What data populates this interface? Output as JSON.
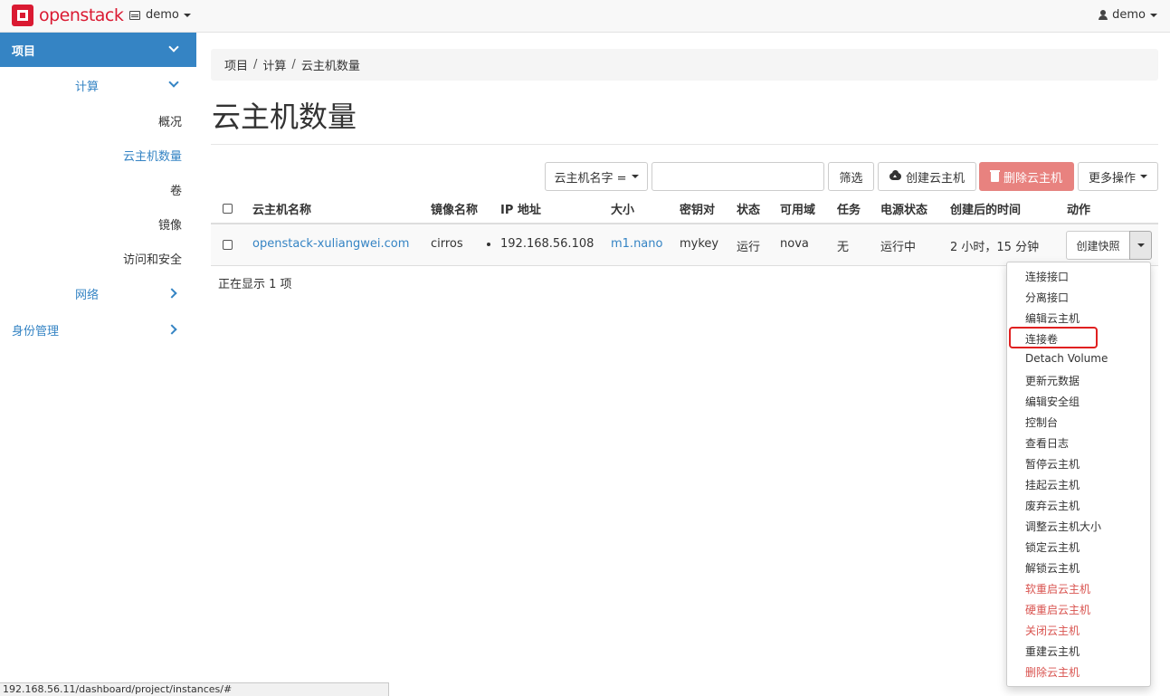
{
  "topbar": {
    "logo_text": "openstack",
    "project_selector": "demo",
    "user_menu": "demo"
  },
  "sidebar": {
    "project": "项目",
    "compute": "计算",
    "items": [
      "概况",
      "云主机数量",
      "卷",
      "镜像",
      "访问和安全"
    ],
    "active_item": "云主机数量",
    "network": "网络",
    "identity": "身份管理"
  },
  "breadcrumb": [
    "项目",
    "计算",
    "云主机数量"
  ],
  "page_title": "云主机数量",
  "toolbar": {
    "filter_field": "云主机名字 =",
    "filter_value": "",
    "filter_button": "筛选",
    "create_button": "创建云主机",
    "delete_button": "删除云主机",
    "more_button": "更多操作"
  },
  "table": {
    "columns": [
      "云主机名称",
      "镜像名称",
      "IP 地址",
      "大小",
      "密钥对",
      "状态",
      "可用域",
      "任务",
      "电源状态",
      "创建后的时间",
      "动作"
    ],
    "rows": [
      {
        "name": "openstack-xuliangwei.com",
        "image": "cirros",
        "ip": "192.168.56.108",
        "size": "m1.nano",
        "keypair": "mykey",
        "status": "运行",
        "zone": "nova",
        "task": "无",
        "power": "运行中",
        "age": "2 小时，15 分钟",
        "action": "创建快照"
      }
    ],
    "count_text": "正在显示 1 项"
  },
  "action_menu": {
    "items": [
      {
        "label": "连接接口",
        "danger": false
      },
      {
        "label": "分离接口",
        "danger": false
      },
      {
        "label": "编辑云主机",
        "danger": false
      },
      {
        "label": "连接卷",
        "danger": false,
        "highlighted": true
      },
      {
        "label": "Detach Volume",
        "danger": false
      },
      {
        "label": "更新元数据",
        "danger": false
      },
      {
        "label": "编辑安全组",
        "danger": false
      },
      {
        "label": "控制台",
        "danger": false
      },
      {
        "label": "查看日志",
        "danger": false
      },
      {
        "label": "暂停云主机",
        "danger": false
      },
      {
        "label": "挂起云主机",
        "danger": false
      },
      {
        "label": "废弃云主机",
        "danger": false
      },
      {
        "label": "调整云主机大小",
        "danger": false
      },
      {
        "label": "锁定云主机",
        "danger": false
      },
      {
        "label": "解锁云主机",
        "danger": false
      },
      {
        "label": "软重启云主机",
        "danger": true
      },
      {
        "label": "硬重启云主机",
        "danger": true
      },
      {
        "label": "关闭云主机",
        "danger": true
      },
      {
        "label": "重建云主机",
        "danger": false
      },
      {
        "label": "删除云主机",
        "danger": true
      }
    ]
  },
  "status_url": "192.168.56.11/dashboard/project/instances/#",
  "colors": {
    "brand_red": "#da1a32",
    "primary_blue": "#3584c4",
    "danger_button": "#e8827f",
    "danger_text": "#d9534f",
    "highlight_box": "#e02020"
  }
}
